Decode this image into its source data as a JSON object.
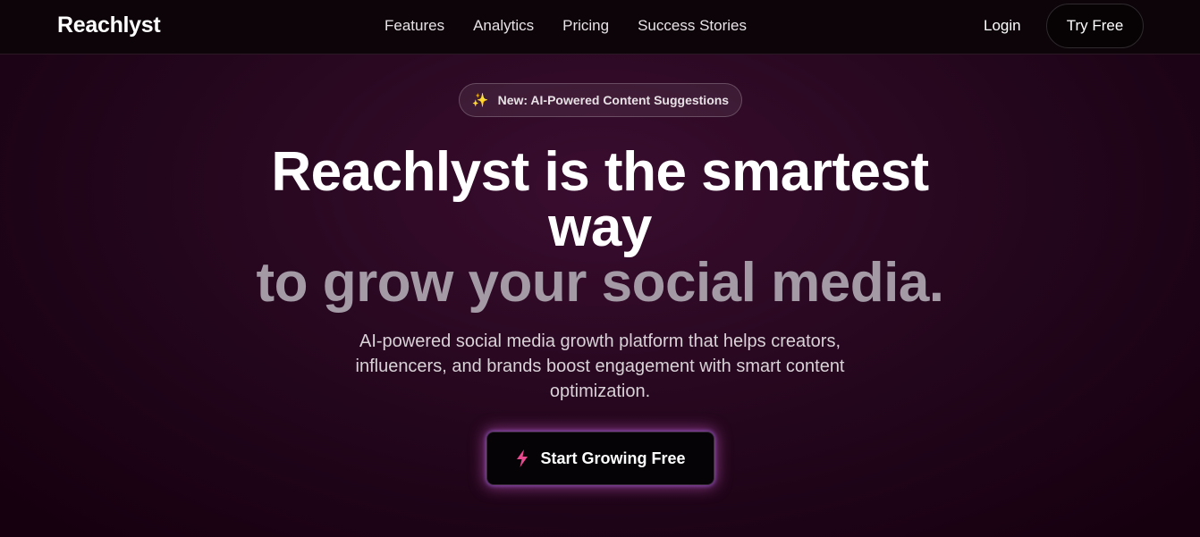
{
  "nav": {
    "brand": "Reachlyst",
    "links": [
      "Features",
      "Analytics",
      "Pricing",
      "Success Stories"
    ],
    "login": "Login",
    "try_free": "Try Free"
  },
  "badge": {
    "icon": "sparkles-icon",
    "text": "New: AI-Powered Content Suggestions"
  },
  "hero": {
    "title_line1": "Reachlyst is the smartest",
    "title_line2": "way",
    "title_line3": "to grow your social media.",
    "subtitle": "AI-powered social media growth platform that helps creators, influencers, and brands boost engagement with smart content optimization.",
    "cta_icon": "lightning-bolt-icon",
    "cta_label": "Start Growing Free"
  },
  "colors": {
    "accent_pink": "#e84a8f",
    "muted_title": "#a39aa6",
    "background": "#23061c"
  }
}
